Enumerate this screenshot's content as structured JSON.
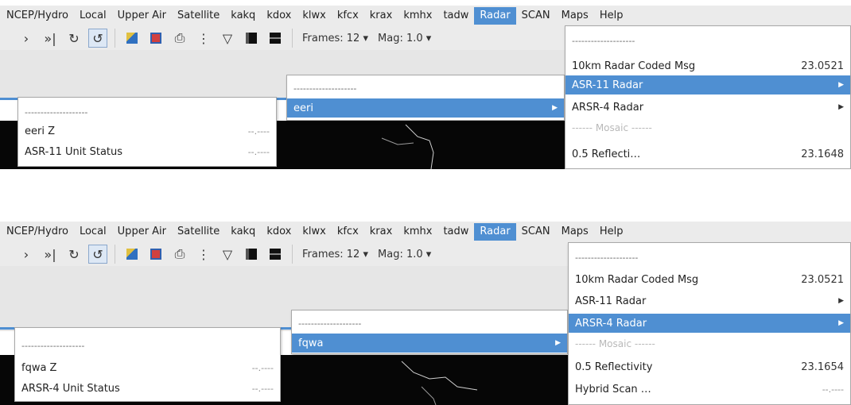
{
  "panels": [
    {
      "menubar": [
        "NCEP/Hydro",
        "Local",
        "Upper Air",
        "Satellite",
        "kakq",
        "kdox",
        "klwx",
        "kfcx",
        "krax",
        "kmhx",
        "tadw",
        "Radar",
        "SCAN",
        "Maps",
        "Help"
      ],
      "toolbar": {
        "icons": [
          "forward-icon",
          "last-frame-icon",
          "loop-icon",
          "rock-icon",
          "clear-icon",
          "image-icon",
          "print-icon",
          "points-icon",
          "baselines-icon",
          "panel-1-icon",
          "panel-4-icon"
        ],
        "frames": "Frames: 12",
        "mag": "Mag: 1.0",
        "dropdown_glyph": "▾"
      },
      "radar_menu": {
        "tearoff": "--------------------",
        "items": [
          {
            "label": "10km Radar Coded Msg",
            "value": "23.0521"
          },
          {
            "label": "ASR-11 Radar",
            "submenu": true,
            "selected": true
          },
          {
            "label": "ARSR-4 Radar",
            "submenu": true
          },
          {
            "label": "Mosaic",
            "separator": true,
            "dashes": "------"
          },
          {
            "label": "0.5 Reflecti…",
            "value": "23.1648"
          }
        ]
      },
      "radar_submenu": {
        "tearoff": "--------------------",
        "items": [
          {
            "label": "eeri",
            "submenu": true,
            "selected": true
          }
        ]
      },
      "site_submenu": {
        "tearoff": "--------------------",
        "items": [
          {
            "label": "eeri Z",
            "value": "--.----"
          },
          {
            "label": "ASR-11 Unit Status",
            "value": "--.----"
          }
        ]
      }
    },
    {
      "menubar": [
        "NCEP/Hydro",
        "Local",
        "Upper Air",
        "Satellite",
        "kakq",
        "kdox",
        "klwx",
        "kfcx",
        "krax",
        "kmhx",
        "tadw",
        "Radar",
        "SCAN",
        "Maps",
        "Help"
      ],
      "toolbar": {
        "icons": [
          "forward-icon",
          "last-frame-icon",
          "loop-icon",
          "rock-icon",
          "clear-icon",
          "image-icon",
          "print-icon",
          "points-icon",
          "baselines-icon",
          "panel-1-icon",
          "panel-4-icon"
        ],
        "frames": "Frames: 12",
        "mag": "Mag: 1.0",
        "dropdown_glyph": "▾"
      },
      "radar_menu": {
        "tearoff": "--------------------",
        "items": [
          {
            "label": "10km Radar Coded Msg",
            "value": "23.0521"
          },
          {
            "label": "ASR-11 Radar",
            "submenu": true
          },
          {
            "label": "ARSR-4 Radar",
            "submenu": true,
            "selected": true
          },
          {
            "label": "Mosaic",
            "separator": true,
            "dashes": "------"
          },
          {
            "label": "0.5 Reflectivity",
            "value": "23.1654"
          },
          {
            "label": "Hybrid Scan …",
            "value": "--.----"
          }
        ]
      },
      "radar_submenu": {
        "tearoff": "--------------------",
        "items": [
          {
            "label": "fqwa",
            "submenu": true,
            "selected": true
          }
        ]
      },
      "site_submenu": {
        "tearoff": "--------------------",
        "items": [
          {
            "label": "fqwa Z",
            "value": "--.----"
          },
          {
            "label": "ARSR-4 Unit Status",
            "value": "--.----"
          }
        ]
      }
    }
  ]
}
